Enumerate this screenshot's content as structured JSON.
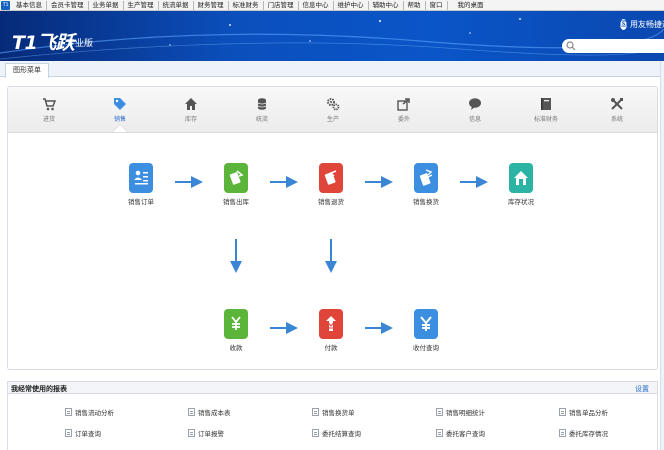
{
  "menubar": {
    "logo": "T1",
    "items": [
      "基本信息",
      "会员卡管理",
      "业务单据",
      "生产管理",
      "统流单据",
      "财务管理",
      "标准财务",
      "门店管理",
      "信息中心",
      "维护中心",
      "辅助中心",
      "帮助",
      "窗口"
    ],
    "desktop": "我的桌面"
  },
  "banner": {
    "brand": "T1飞跃",
    "edition": "专业版",
    "user_link": "用友畅捷通"
  },
  "tabs": {
    "active": "图形菜单"
  },
  "modules": [
    {
      "label": "进货",
      "icon": "cart-icon"
    },
    {
      "label": "销售",
      "icon": "tag-icon"
    },
    {
      "label": "库存",
      "icon": "home-icon"
    },
    {
      "label": "统流",
      "icon": "coins-icon"
    },
    {
      "label": "生产",
      "icon": "gears-icon"
    },
    {
      "label": "委外",
      "icon": "share-icon"
    },
    {
      "label": "信息",
      "icon": "chat-icon"
    },
    {
      "label": "标准财务",
      "icon": "ledger-icon"
    },
    {
      "label": "系统",
      "icon": "tools-icon"
    }
  ],
  "active_module": "销售",
  "flow": {
    "nodes": [
      {
        "label": "销售订单",
        "color": "#3b8ee0",
        "icon": "order-form-icon"
      },
      {
        "label": "销售出库",
        "color": "#5bb53a",
        "icon": "outbound-icon"
      },
      {
        "label": "销售退货",
        "color": "#e0453a",
        "icon": "return-icon"
      },
      {
        "label": "销售换货",
        "color": "#3b8ee0",
        "icon": "exchange-icon"
      },
      {
        "label": "库存状况",
        "color": "#2bb3a3",
        "icon": "warehouse-icon"
      },
      {
        "label": "收款",
        "color": "#5bb53a",
        "icon": "yen-down-icon"
      },
      {
        "label": "付款",
        "color": "#e0453a",
        "icon": "yen-up-icon"
      },
      {
        "label": "收付查询",
        "color": "#3b8ee0",
        "icon": "yen-icon"
      }
    ],
    "arrow_color": "#3a86d4"
  },
  "reports": {
    "title": "我经常使用的报表",
    "settings": "设置",
    "items": [
      "销售流动分析",
      "销售成本表",
      "销售换货单",
      "销售明细统计",
      "销售单品分析",
      "订单查询",
      "订单报警",
      "委托结算查询",
      "委托客户查询",
      "委托库存情况"
    ]
  }
}
